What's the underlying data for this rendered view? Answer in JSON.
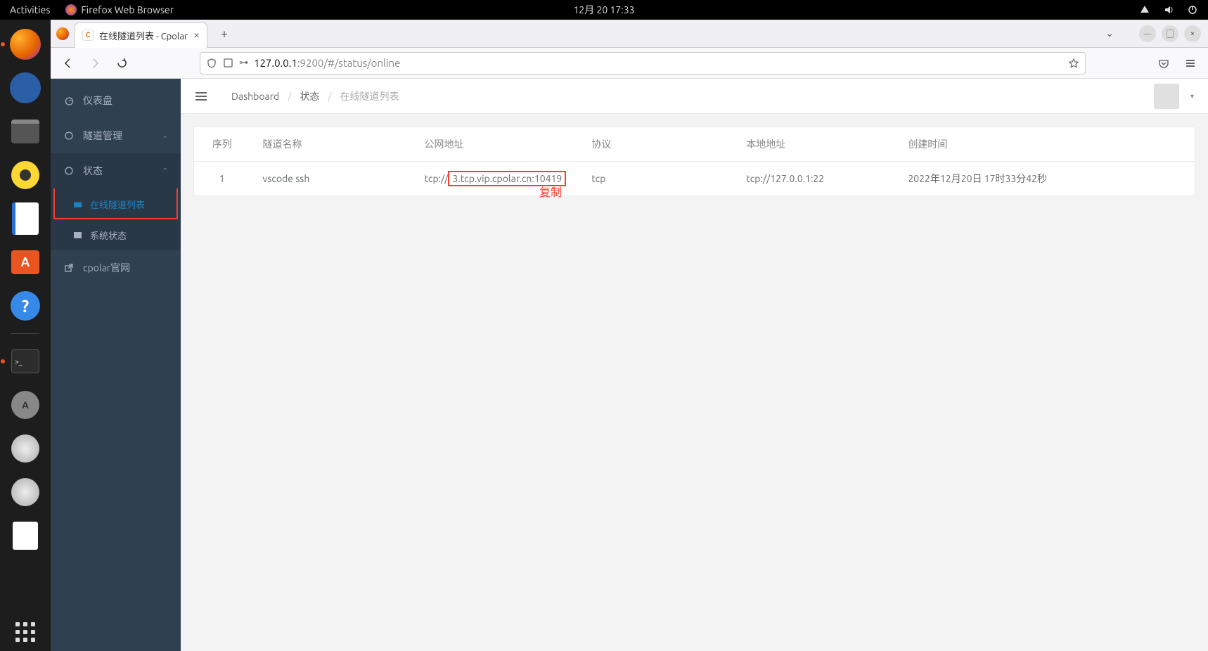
{
  "gnome": {
    "activities": "Activities",
    "app_name": "Firefox Web Browser",
    "clock": "12月 20  17:33"
  },
  "firefox": {
    "tab_title": "在线隧道列表 - Cpolar",
    "favicon_letter": "C",
    "url_prefix": "127.0.0.1",
    "url_suffix": ":9200/#/status/online"
  },
  "sidebar": {
    "dashboard": "仪表盘",
    "tunnel_mgmt": "隧道管理",
    "status": "状态",
    "online_list": "在线隧道列表",
    "sys_status": "系统状态",
    "official": "cpolar官网"
  },
  "breadcrumb": {
    "b1": "Dashboard",
    "b2": "状态",
    "b3": "在线隧道列表"
  },
  "table": {
    "headers": {
      "seq": "序列",
      "name": "隧道名称",
      "public": "公网地址",
      "proto": "协议",
      "local": "本地地址",
      "created": "创建时间"
    },
    "rows": [
      {
        "seq": "1",
        "name": "vscode ssh",
        "public_pre": "tcp://",
        "public_hl": "3.tcp.vip.cpolar.cn:10419",
        "proto": "tcp",
        "local": "tcp://127.0.0.1:22",
        "created": "2022年12月20日 17时33分42秒"
      }
    ]
  },
  "annotation": {
    "copy": "复制"
  }
}
